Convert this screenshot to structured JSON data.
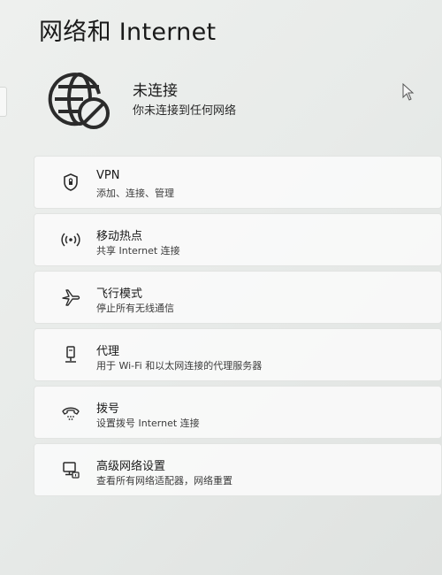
{
  "page": {
    "title": "网络和 Internet"
  },
  "status": {
    "title": "未连接",
    "subtitle": "你未连接到任何网络",
    "icon": "globe-disconnected-icon"
  },
  "items": [
    {
      "title": "VPN",
      "subtitle": "添加、连接、管理",
      "icon": "shield-icon"
    },
    {
      "title": "移动热点",
      "subtitle": "共享 Internet 连接",
      "icon": "hotspot-icon"
    },
    {
      "title": "飞行模式",
      "subtitle": "停止所有无线通信",
      "icon": "airplane-icon"
    },
    {
      "title": "代理",
      "subtitle": "用于 Wi-Fi 和以太网连接的代理服务器",
      "icon": "proxy-server-icon"
    },
    {
      "title": "拨号",
      "subtitle": "设置拨号 Internet 连接",
      "icon": "dialup-phone-icon"
    },
    {
      "title": "高级网络设置",
      "subtitle": "查看所有网络适配器，网络重置",
      "icon": "network-adapter-icon"
    }
  ]
}
